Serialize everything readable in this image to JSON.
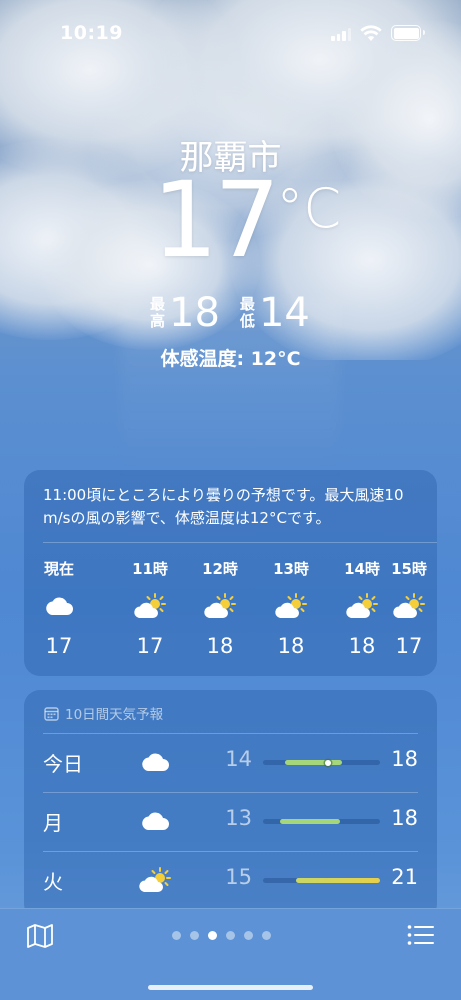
{
  "status_bar": {
    "time": "10:19"
  },
  "location": {
    "city": "那覇市"
  },
  "current": {
    "temperature": "17",
    "unit": "°C",
    "high_label": [
      "最",
      "高"
    ],
    "high": "18",
    "low_label": [
      "最",
      "低"
    ],
    "low": "14",
    "feels_like": "体感温度: 12°C"
  },
  "hourly": {
    "summary": "11:00頃にところにより曇りの予想です。最大風速10 m/sの風の影響で、体感温度は12°Cです。",
    "items": [
      {
        "hour": "現在",
        "icon": "cloud-icon",
        "temp": "17"
      },
      {
        "hour": "11時",
        "icon": "partly-sunny-icon",
        "temp": "17"
      },
      {
        "hour": "12時",
        "icon": "partly-sunny-icon",
        "temp": "18"
      },
      {
        "hour": "13時",
        "icon": "partly-sunny-icon",
        "temp": "18"
      },
      {
        "hour": "14時",
        "icon": "partly-sunny-icon",
        "temp": "18"
      },
      {
        "hour": "15時",
        "icon": "partly-sunny-icon",
        "temp": "17"
      }
    ]
  },
  "daily": {
    "header": "10日間天気予報",
    "days": [
      {
        "day": "今日",
        "icon": "cloud-icon",
        "low": "14",
        "high": "18",
        "current_marker": true
      },
      {
        "day": "月",
        "icon": "cloud-icon",
        "low": "13",
        "high": "18",
        "current_marker": false
      },
      {
        "day": "火",
        "icon": "partly-sunny-icon",
        "low": "15",
        "high": "21",
        "current_marker": false
      }
    ]
  },
  "pagination": {
    "count": 6,
    "active_index": 2
  },
  "colors": {
    "range_green": "#a6d67a",
    "range_yellow": "#e7d04a",
    "background_blue": "#4f88d3"
  }
}
